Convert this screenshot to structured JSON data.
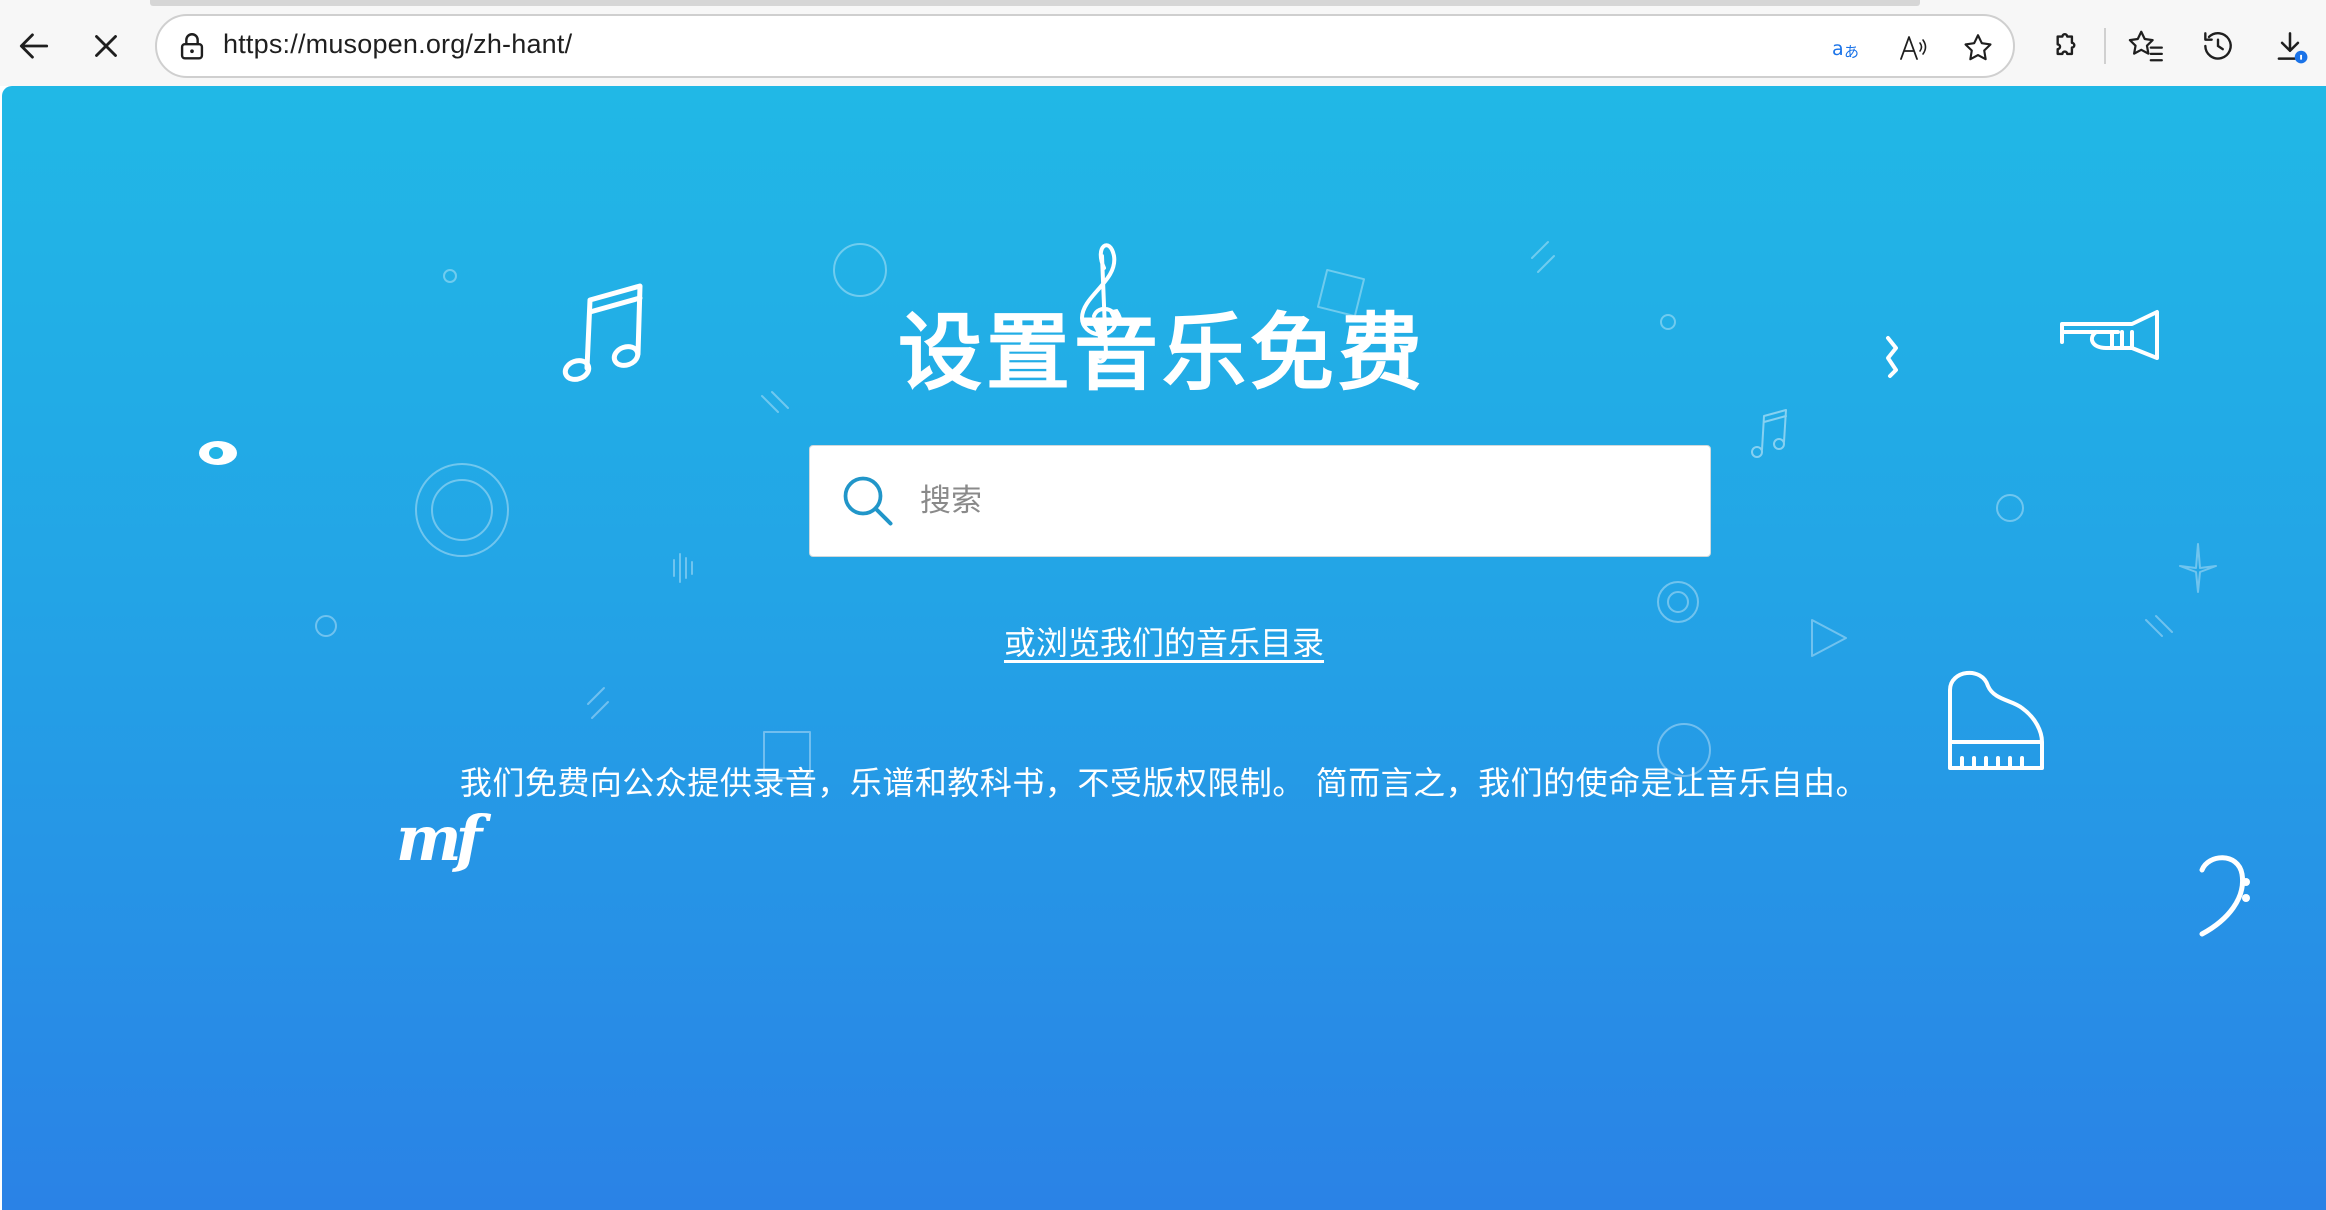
{
  "browser": {
    "url": "https://musopen.org/zh-hant/",
    "icons": [
      "back-icon",
      "stop-icon",
      "lock-icon",
      "translate-icon",
      "read-aloud-icon",
      "favorite-star-icon",
      "extensions-icon",
      "favorites-icon",
      "history-icon",
      "downloads-icon"
    ],
    "download_badge_color": "#1a73e8"
  },
  "hero": {
    "title": "设置音乐免费",
    "search_placeholder": "搜索",
    "browse_link": "或浏览我们的音乐目录",
    "tagline": "我们免费向公众提供录音，乐谱和教科书，不受版权限制。 简而言之，我们的使命是让音乐自由。",
    "dynamic_mark": "mf"
  },
  "colors": {
    "gradient_top": "#21b8e6",
    "gradient_bottom": "#2a82e6",
    "decor_white": "#ffffff"
  }
}
